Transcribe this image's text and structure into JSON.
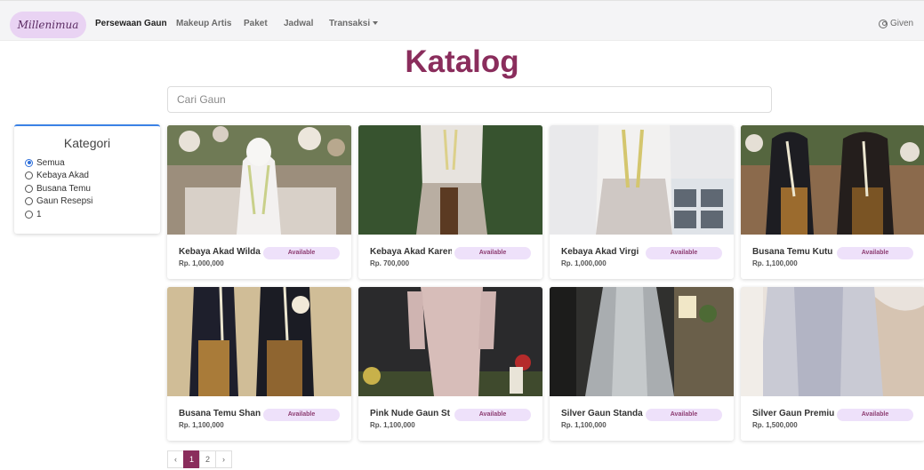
{
  "navbar": {
    "brand": "Millenimua",
    "links": [
      {
        "label": "Persewaan Gaun",
        "active": true
      },
      {
        "label": "Makeup Artis",
        "active": false
      },
      {
        "label": "Paket",
        "active": false
      },
      {
        "label": "Jadwal",
        "active": false
      },
      {
        "label": "Transaksi",
        "active": false
      }
    ],
    "user": "Given",
    "user_icon": "user-circle-icon"
  },
  "page_title": "Katalog",
  "search": {
    "placeholder": "Cari Gaun",
    "value": ""
  },
  "kategori": {
    "title": "Kategori",
    "options": [
      {
        "label": "Semua",
        "checked": true
      },
      {
        "label": "Kebaya Akad",
        "checked": false
      },
      {
        "label": "Busana Temu",
        "checked": false
      },
      {
        "label": "Gaun Resepsi",
        "checked": false
      },
      {
        "label": "1",
        "checked": false
      }
    ]
  },
  "products": [
    {
      "name": "Kebaya Akad Wilda",
      "price": "Rp. 1,000,000",
      "status": "Available"
    },
    {
      "name": "Kebaya Akad Karen",
      "price": "Rp. 700,000",
      "status": "Available"
    },
    {
      "name": "Kebaya Akad Virgi",
      "price": "Rp. 1,000,000",
      "status": "Available"
    },
    {
      "name": "Busana Temu Kutu",
      "price": "Rp. 1,100,000",
      "status": "Available"
    },
    {
      "name": "Busana Temu Shan",
      "price": "Rp. 1,100,000",
      "status": "Available"
    },
    {
      "name": "Pink Nude Gaun St",
      "price": "Rp. 1,100,000",
      "status": "Available"
    },
    {
      "name": "Silver Gaun Standa",
      "price": "Rp. 1,100,000",
      "status": "Available"
    },
    {
      "name": "Silver Gaun Premiu",
      "price": "Rp. 1,500,000",
      "status": "Available"
    }
  ],
  "pagination": {
    "prev": "‹",
    "pages": [
      "1",
      "2"
    ],
    "current": "1",
    "next": "›"
  },
  "colors": {
    "accent": "#8a2d5c",
    "badge_bg": "#eee1fa",
    "brand_bg": "#e9d3f3",
    "kategori_border": "#3b82e6"
  }
}
